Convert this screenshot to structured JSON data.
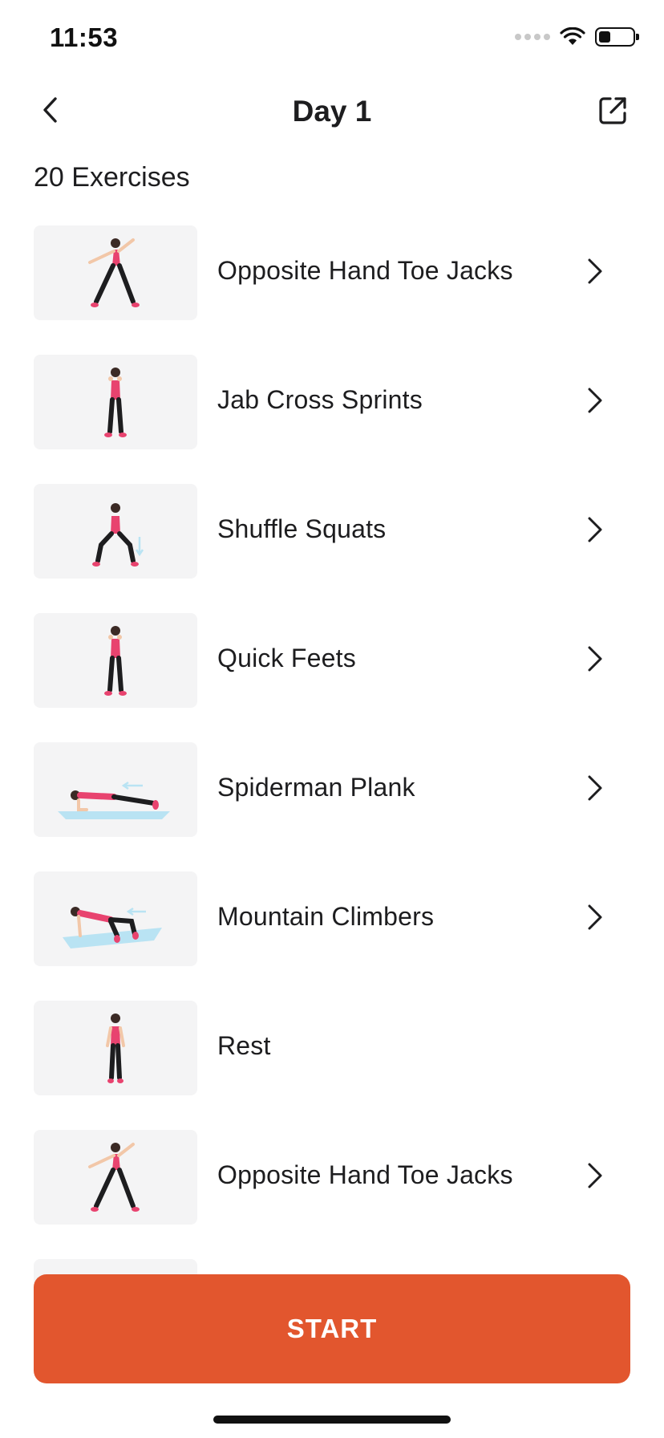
{
  "status_bar": {
    "time": "11:53"
  },
  "nav": {
    "title": "Day 1"
  },
  "summary": {
    "count_label": "20 Exercises"
  },
  "exercises": [
    {
      "name": "Opposite Hand Toe Jacks",
      "has_detail": true,
      "figure": "toe-jacks"
    },
    {
      "name": "Jab Cross Sprints",
      "has_detail": true,
      "figure": "standing-fists"
    },
    {
      "name": "Shuffle Squats",
      "has_detail": true,
      "figure": "squat"
    },
    {
      "name": "Quick Feets",
      "has_detail": true,
      "figure": "standing-fists"
    },
    {
      "name": "Spiderman Plank",
      "has_detail": true,
      "figure": "plank"
    },
    {
      "name": "Mountain Climbers",
      "has_detail": true,
      "figure": "climber"
    },
    {
      "name": "Rest",
      "has_detail": false,
      "figure": "standing-relaxed"
    },
    {
      "name": "Opposite Hand Toe Jacks",
      "has_detail": true,
      "figure": "toe-jacks"
    }
  ],
  "start_button": {
    "label": "START"
  },
  "colors": {
    "accent": "#e2562e",
    "thumb_bg": "#f4f4f5",
    "figure_top": "#e8436f",
    "mat": "#b9e3f3"
  },
  "icons": {
    "back": "chevron-left-icon",
    "share": "external-link-icon",
    "row": "chevron-right-icon"
  }
}
